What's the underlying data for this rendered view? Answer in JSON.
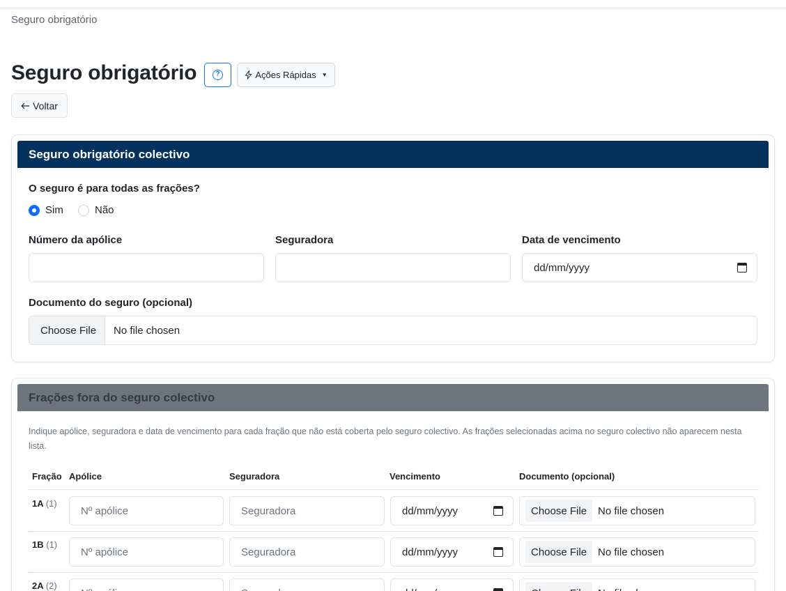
{
  "breadcrumb": "Seguro obrigatório",
  "page_title": "Seguro obrigatório",
  "help_icon": "question-circle-icon",
  "quick_actions": {
    "label": "Ações Rápidas",
    "icon": "lightning-icon"
  },
  "back": {
    "label": "Voltar",
    "icon": "arrow-left-icon"
  },
  "collective": {
    "header": "Seguro obrigatório colectivo",
    "question": "O seguro é para todas as frações?",
    "options": [
      {
        "label": "Sim",
        "checked": true
      },
      {
        "label": "Não",
        "checked": false
      }
    ],
    "policy_label": "Número da apólice",
    "policy_value": "",
    "insurer_label": "Seguradora",
    "insurer_value": "",
    "expiry_label": "Data de vencimento",
    "expiry_placeholder": "dd/mm/yyyy",
    "document_label": "Documento do seguro (opcional)",
    "file_button": "Choose File",
    "file_status": "No file chosen"
  },
  "excluded": {
    "header": "Frações fora do seguro colectivo",
    "help": "Indique apólice, seguradora e data de vencimento para cada fração que não está coberta pelo seguro colectivo. As frações selecionadas acima no seguro colectivo não aparecem nesta lista.",
    "columns": [
      "Fração",
      "Apólice",
      "Seguradora",
      "Vencimento",
      "Documento (opcional)"
    ],
    "policy_placeholder": "Nº apólice",
    "insurer_placeholder": "Seguradora",
    "date_placeholder": "dd/mm/yyyy",
    "file_button": "Choose File",
    "file_status": "No file chosen",
    "rows": [
      {
        "fraction": "1A",
        "count": "(1)"
      },
      {
        "fraction": "1B",
        "count": "(1)"
      },
      {
        "fraction": "2A",
        "count": "(2)"
      }
    ]
  }
}
